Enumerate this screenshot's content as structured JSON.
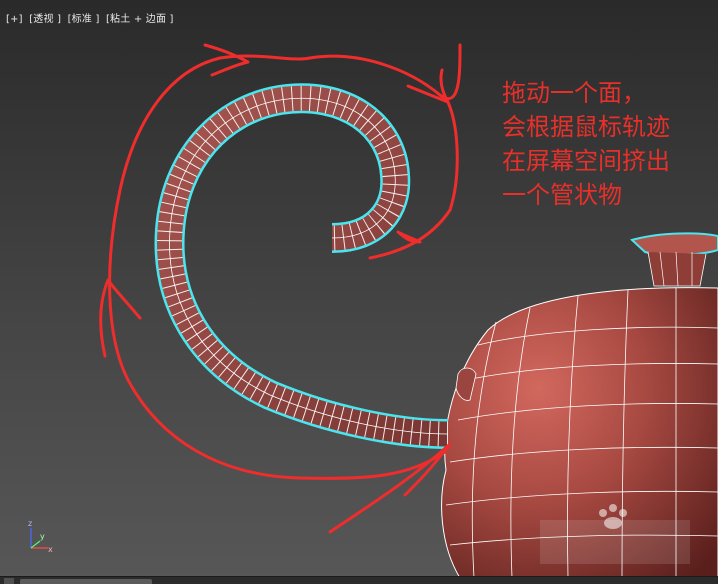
{
  "viewport": {
    "label_items": [
      "[+]",
      "[透视 ]",
      "[标准 ]",
      "[粘土 + 边面 ]"
    ]
  },
  "annotation": {
    "lines": [
      "拖动一个面，",
      "会根据鼠标轨迹",
      "在屏幕空间挤出",
      "一个管状物"
    ],
    "color": "#e8302a"
  },
  "axis_gizmo": {
    "z_label": "z",
    "x_label": "x",
    "y_label": "y"
  },
  "colors": {
    "model": "#a84a42",
    "selection_outline": "#49e6f0",
    "wireframe": "#ffffff",
    "stroke": "#ef2d2d"
  },
  "icons": [
    "axis-gizmo-icon",
    "paw-print-watermark-icon"
  ]
}
